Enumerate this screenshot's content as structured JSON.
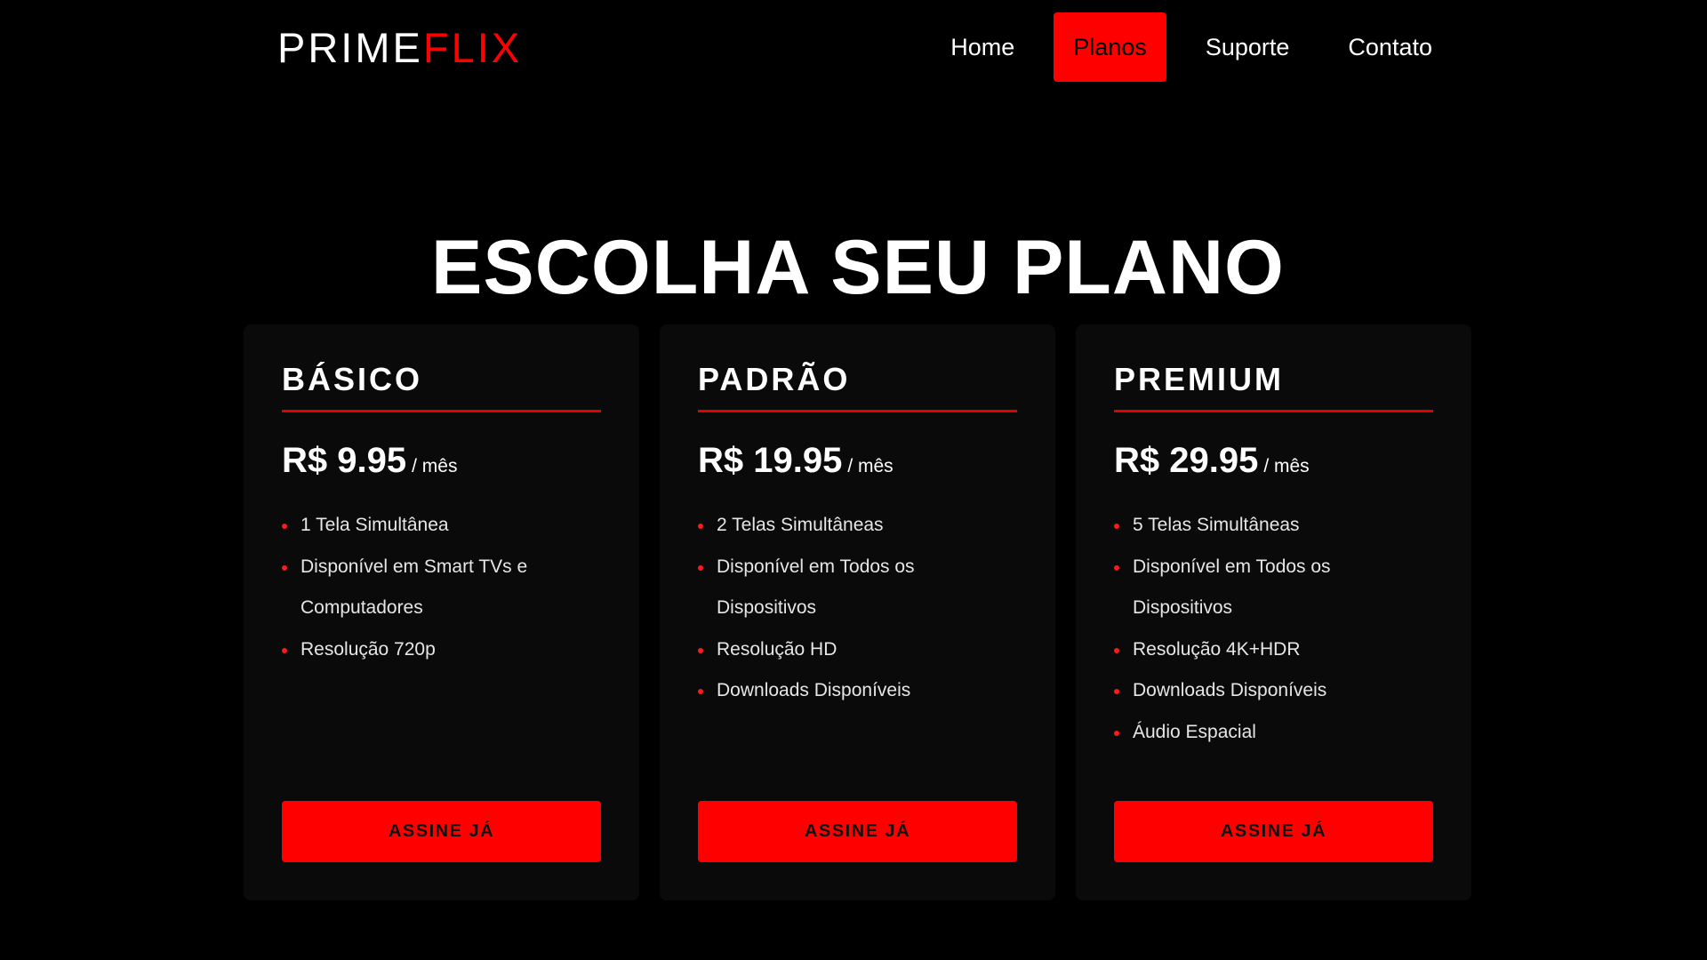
{
  "brand": {
    "logo_part1": "PRIME",
    "logo_part2": "FLIX"
  },
  "nav": {
    "items": [
      {
        "label": "Home",
        "active": false
      },
      {
        "label": "Planos",
        "active": true
      },
      {
        "label": "Suporte",
        "active": false
      },
      {
        "label": "Contato",
        "active": false
      }
    ]
  },
  "page": {
    "title": "ESCOLHA SEU PLANO"
  },
  "plans": [
    {
      "name": "BÁSICO",
      "price": "R$ 9.95",
      "period": "/ mês",
      "features": [
        "1 Tela Simultânea",
        "Disponível em Smart TVs e Computadores",
        "Resolução 720p"
      ],
      "button_label": "ASSINE JÁ"
    },
    {
      "name": "PADRÃO",
      "price": "R$ 19.95",
      "period": "/ mês",
      "features": [
        "2 Telas Simultâneas",
        "Disponível em Todos os Dispositivos",
        "Resolução HD",
        "Downloads Disponíveis"
      ],
      "button_label": "ASSINE JÁ"
    },
    {
      "name": "PREMIUM",
      "price": "R$ 29.95",
      "period": "/ mês",
      "features": [
        "5 Telas Simultâneas",
        "Disponível em Todos os Dispositivos",
        "Resolução 4K+HDR",
        "Downloads Disponíveis",
        "Áudio Espacial"
      ],
      "button_label": "ASSINE JÁ"
    }
  ],
  "colors": {
    "accent": "#ff0000",
    "background": "#000000",
    "card_background": "#0a0a0a"
  }
}
